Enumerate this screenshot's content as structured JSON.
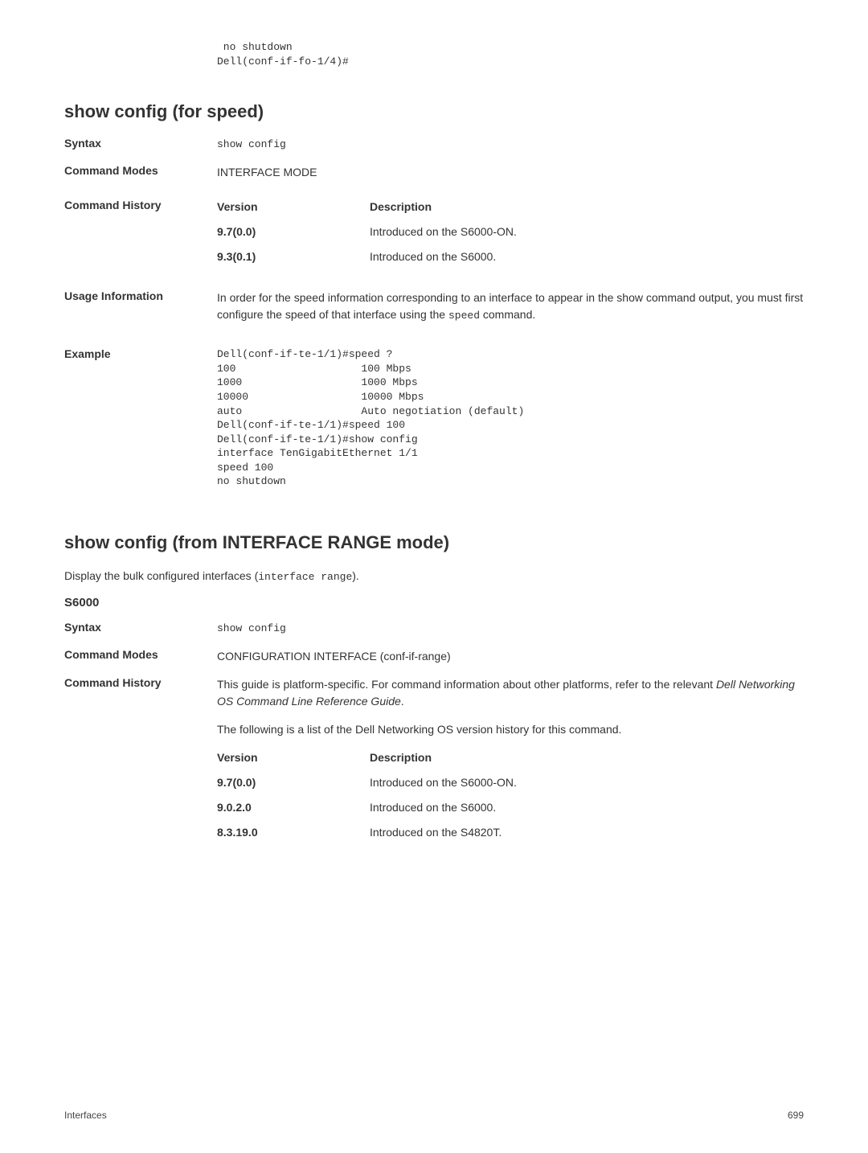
{
  "intro_code": " no shutdown\nDell(conf-if-fo-1/4)#",
  "section1": {
    "heading": "show config (for speed)",
    "syntax_label": "Syntax",
    "syntax_value": "show config",
    "command_modes_label": "Command Modes",
    "command_modes_value": "INTERFACE MODE",
    "command_history_label": "Command History",
    "version_header": "Version",
    "description_header": "Description",
    "history": [
      {
        "version": "9.7(0.0)",
        "desc": "Introduced on the S6000-ON."
      },
      {
        "version": "9.3(0.1)",
        "desc": "Introduced on the S6000."
      }
    ],
    "usage_label": "Usage Information",
    "usage_text_1": "In order for the speed information corresponding to an interface to appear in the show command output, you must first configure the speed of that interface using the ",
    "usage_code": "speed",
    "usage_text_2": " command.",
    "example_label": "Example",
    "example_code": "Dell(conf-if-te-1/1)#speed ?\n100                    100 Mbps\n1000                   1000 Mbps\n10000                  10000 Mbps\nauto                   Auto negotiation (default)\nDell(conf-if-te-1/1)#speed 100\nDell(conf-if-te-1/1)#show config\ninterface TenGigabitEthernet 1/1\nspeed 100\nno shutdown"
  },
  "section2": {
    "heading": "show config (from INTERFACE RANGE mode)",
    "intro_1": "Display the bulk configured interfaces (",
    "intro_code": "interface range",
    "intro_2": ").",
    "subheading": "S6000",
    "syntax_label": "Syntax",
    "syntax_value": "show config",
    "command_modes_label": "Command Modes",
    "command_modes_value": "CONFIGURATION INTERFACE (conf-if-range)",
    "command_history_label": "Command History",
    "history_intro_1": "This guide is platform-specific. For command information about other platforms, refer to the relevant ",
    "history_intro_italic": "Dell Networking OS Command Line Reference Guide",
    "history_intro_2": ".",
    "history_intro_3": "The following is a list of the Dell Networking OS version history for this command.",
    "version_header": "Version",
    "description_header": "Description",
    "history": [
      {
        "version": "9.7(0.0)",
        "desc": "Introduced on the S6000-ON."
      },
      {
        "version": "9.0.2.0",
        "desc": "Introduced on the S6000."
      },
      {
        "version": "8.3.19.0",
        "desc": "Introduced on the S4820T."
      }
    ]
  },
  "footer": {
    "left": "Interfaces",
    "right": "699"
  }
}
